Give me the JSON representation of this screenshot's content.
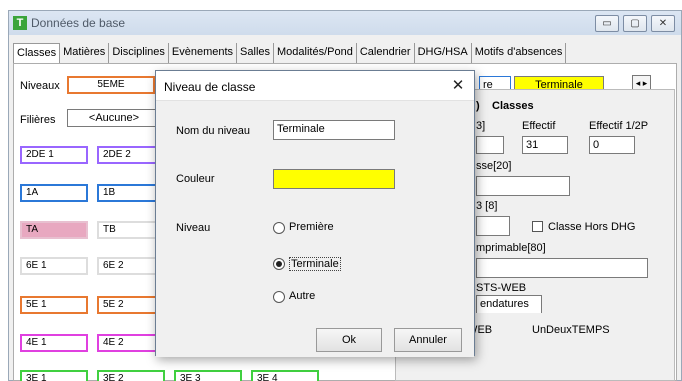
{
  "window": {
    "title": "Données de base",
    "app_icon": "T",
    "controls": {
      "minimize": "▭",
      "maximize": "▢",
      "close": "✕"
    }
  },
  "tabs": [
    "Classes",
    "Matières",
    "Disciplines",
    "Evènements",
    "Salles",
    "Modalités/Pond",
    "Calendrier",
    "DHG/HSA",
    "Motifs d'absences"
  ],
  "filters": {
    "niveaux_label": "Niveaux",
    "niveaux_value": "5EME",
    "filieres_label": "Filières",
    "filieres_value": "<Aucune>",
    "right_niveau_partial": "re",
    "right_niveau_selected": "Terminale",
    "arrows": "◂ ▸"
  },
  "classes": {
    "row1": [
      "2DE 1",
      "2DE 2"
    ],
    "row2": [
      "1A",
      "1B"
    ],
    "row3": [
      "TA",
      "TB"
    ],
    "row4": [
      "6E 1",
      "6E 2"
    ],
    "row5": [
      "5E 1",
      "5E 2"
    ],
    "row6": [
      "4E 1",
      "4E 2"
    ],
    "row7": [
      "3E 1",
      "3E 2",
      "3E 3",
      "3E 4"
    ]
  },
  "right_panel": {
    "header_fragment": ")",
    "header": "Classes",
    "col1_fragment": "3]",
    "effectif_label": "Effectif",
    "effectif_value": "31",
    "effectif12_label": "Effectif 1/2P",
    "effectif12_value": "0",
    "libelle_fragment": "sse[20]",
    "code_fragment": "3 [8]",
    "hors_dhg_label": "Classe Hors DHG",
    "imprimable_fragment": "mprimable[80]",
    "sts_fragment": "STS-WEB",
    "nomenclatures_tab": "endatures",
    "sts_col": "STS-WEB",
    "undeux_col": "UnDeuxTEMPS"
  },
  "dialog": {
    "title": "Niveau de classe",
    "close": "✕",
    "nom_label": "Nom du niveau",
    "nom_value": "Terminale",
    "couleur_label": "Couleur",
    "couleur_value": "#ffff00",
    "niveau_label": "Niveau",
    "options": [
      "Première",
      "Terminale",
      "Autre"
    ],
    "selected_option": "Terminale",
    "ok": "Ok",
    "cancel": "Annuler"
  },
  "colors": {
    "yellow": "#ffff00",
    "purple": "#9966ff",
    "blue": "#2b78d8",
    "pink": "#e8a8c0",
    "orange": "#e87830",
    "magenta": "#e040e0",
    "green": "#40d040"
  }
}
